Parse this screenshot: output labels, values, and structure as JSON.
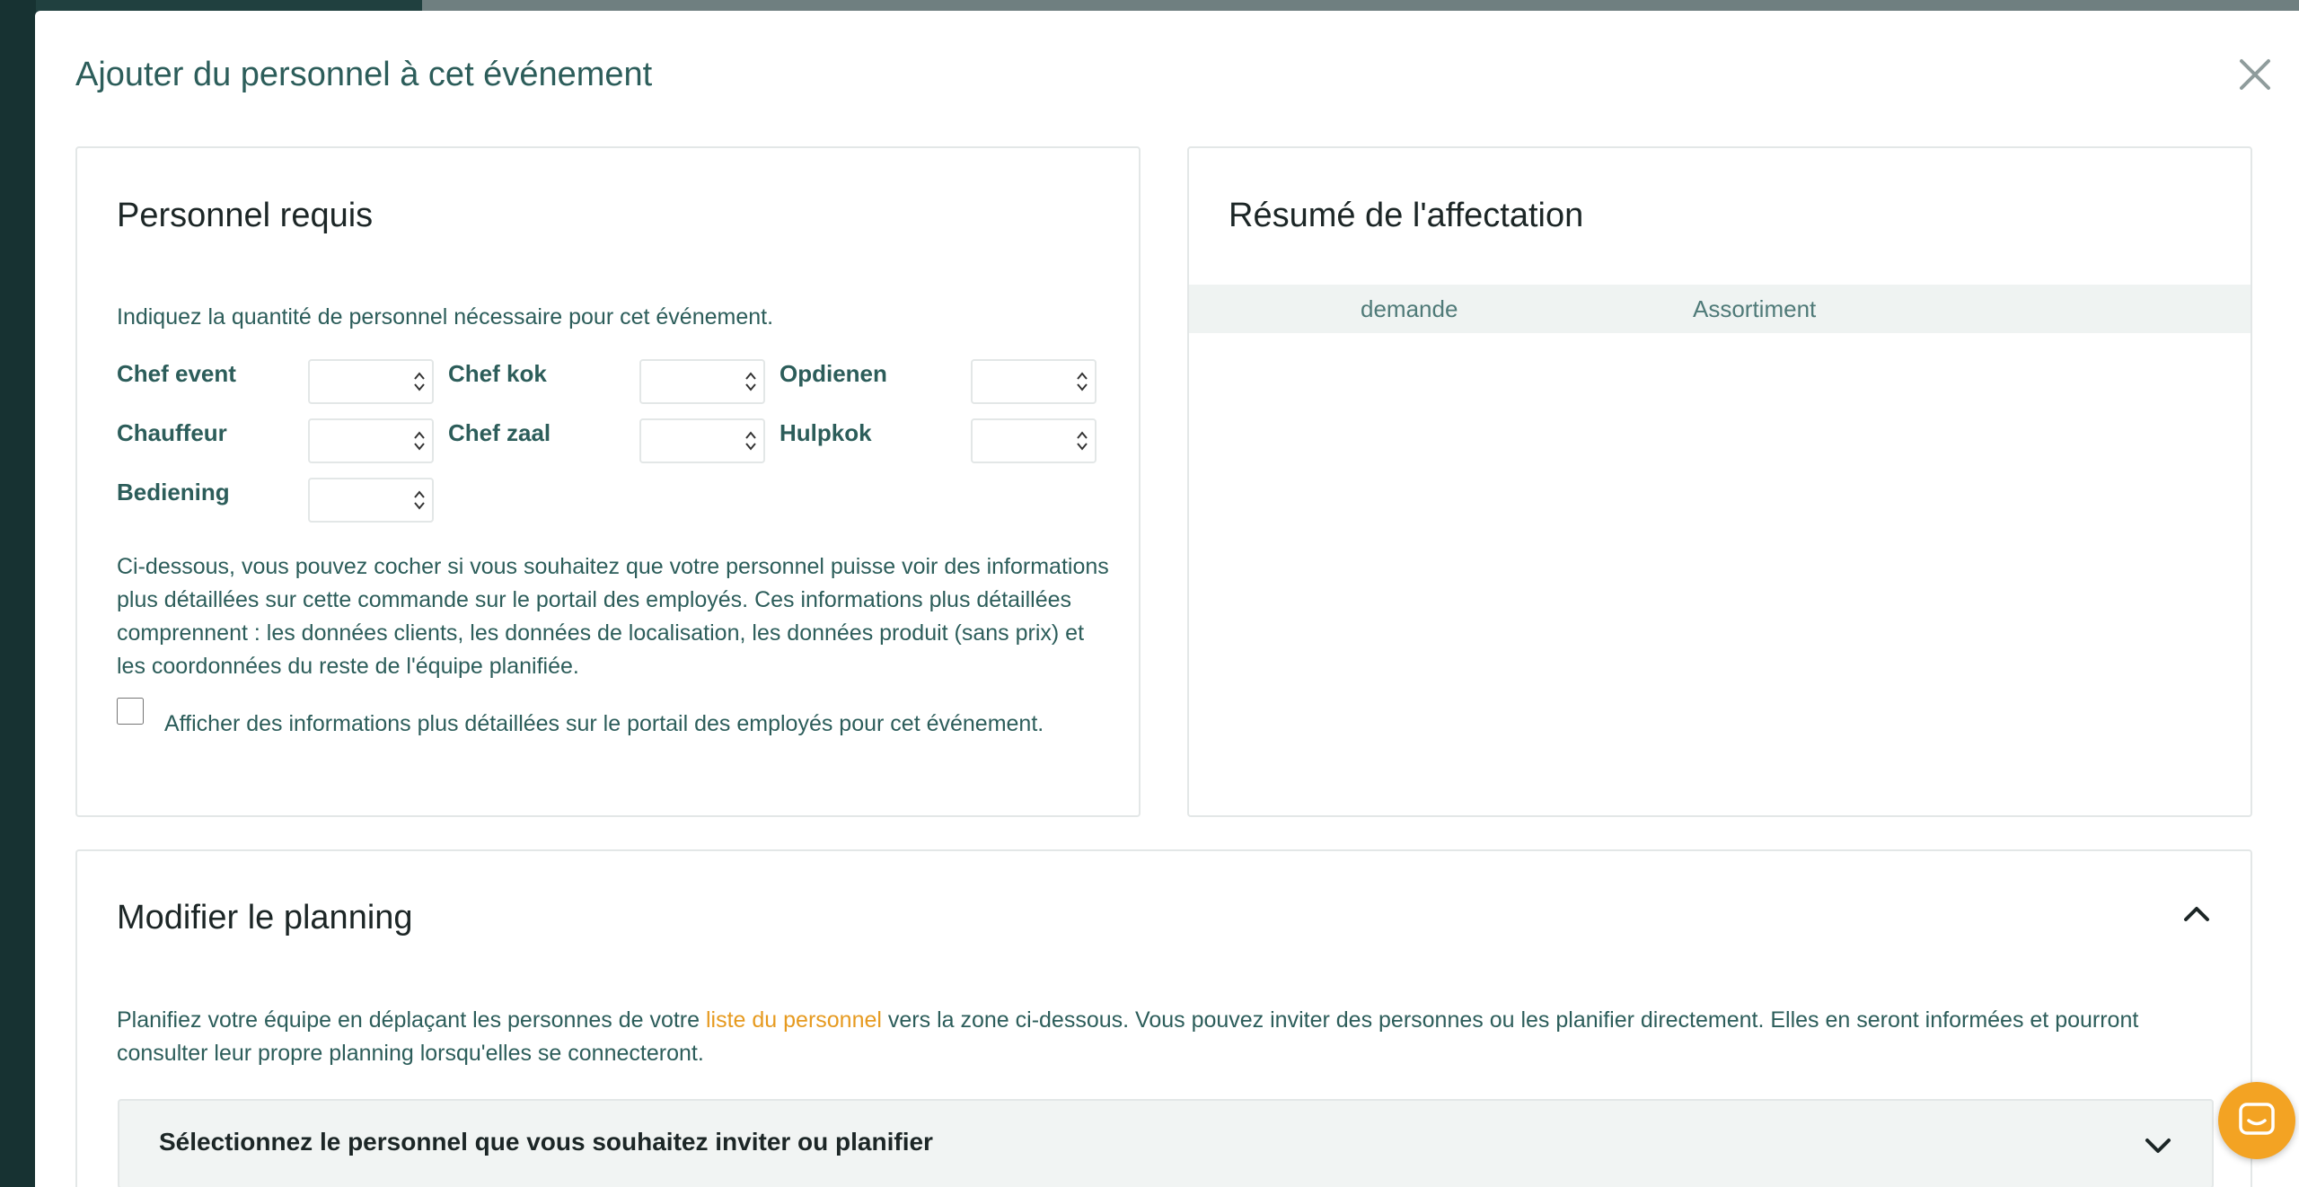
{
  "modal": {
    "title": "Ajouter du personnel à cet événement",
    "close_icon": "close-icon"
  },
  "required_staff": {
    "title": "Personnel requis",
    "intro": "Indiquez la quantité de personnel nécessaire pour cet événement.",
    "roles": [
      {
        "label": "Chef event",
        "value": ""
      },
      {
        "label": "Chef kok",
        "value": ""
      },
      {
        "label": "Opdienen",
        "value": ""
      },
      {
        "label": "Chauffeur",
        "value": ""
      },
      {
        "label": "Chef zaal",
        "value": ""
      },
      {
        "label": "Hulpkok",
        "value": ""
      },
      {
        "label": "Bediening",
        "value": ""
      }
    ],
    "detail_info": "Ci-dessous, vous pouvez cocher si vous souhaitez que votre personnel puisse voir des informations plus détaillées sur cette commande sur le portail des employés. Ces informations plus détaillées comprennent : les données clients, les données de localisation, les données produit (sans prix) et les coordonnées du reste de l'équipe planifiée.",
    "checkbox_label": "Afficher des informations plus détaillées sur le portail des employés pour cet événement.",
    "checkbox_checked": false
  },
  "summary": {
    "title": "Résumé de l'affectation",
    "columns": [
      "demande",
      "Assortiment"
    ]
  },
  "planning": {
    "title": "Modifier le planning",
    "text_before": "Planifiez votre équipe en déplaçant les personnes de votre ",
    "link_text": "liste du personnel",
    "text_after": " vers la zone ci-dessous. Vous pouvez inviter des personnes ou les planifier directement. Elles en seront informées et pourront consulter leur propre planning lorsqu'elles se connecteront.",
    "select_label": "Sélectionnez le personnel que vous souhaitez inviter ou planifier",
    "collapse_icon": "chevron-up-icon",
    "select_icon": "chevron-down-icon"
  },
  "chat": {
    "icon": "chat-icon"
  },
  "colors": {
    "accent_text": "#2c5d5a",
    "link": "#e69a1f",
    "chat_button": "#f3a323",
    "summary_header_bg": "#eff3f2"
  }
}
